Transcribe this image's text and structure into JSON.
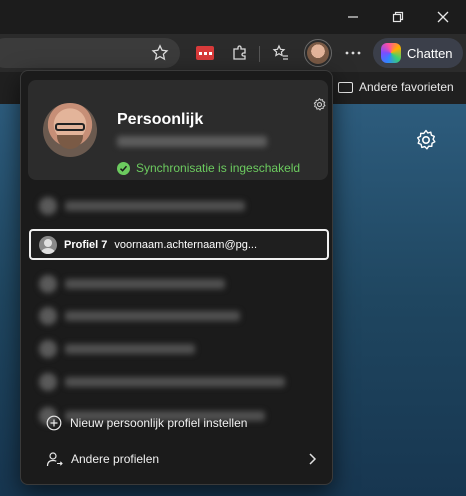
{
  "toolbar": {
    "chat_label": "Chatten"
  },
  "favorites": {
    "folder_label": "Andere favorieten"
  },
  "profile_menu": {
    "card": {
      "name": "Persoonlijk",
      "sync_status": "Synchronisatie is ingeschakeld"
    },
    "active_profile": {
      "name": "Profiel 7",
      "email": "voornaam.achternaam@pg..."
    },
    "actions": {
      "new_profile": "Nieuw persoonlijk profiel instellen",
      "other_profiles": "Andere profielen"
    }
  },
  "colors": {
    "sync_green": "#6ccb5f",
    "flyout_bg": "#1b1b1b",
    "card_bg": "#2c2c2c"
  }
}
